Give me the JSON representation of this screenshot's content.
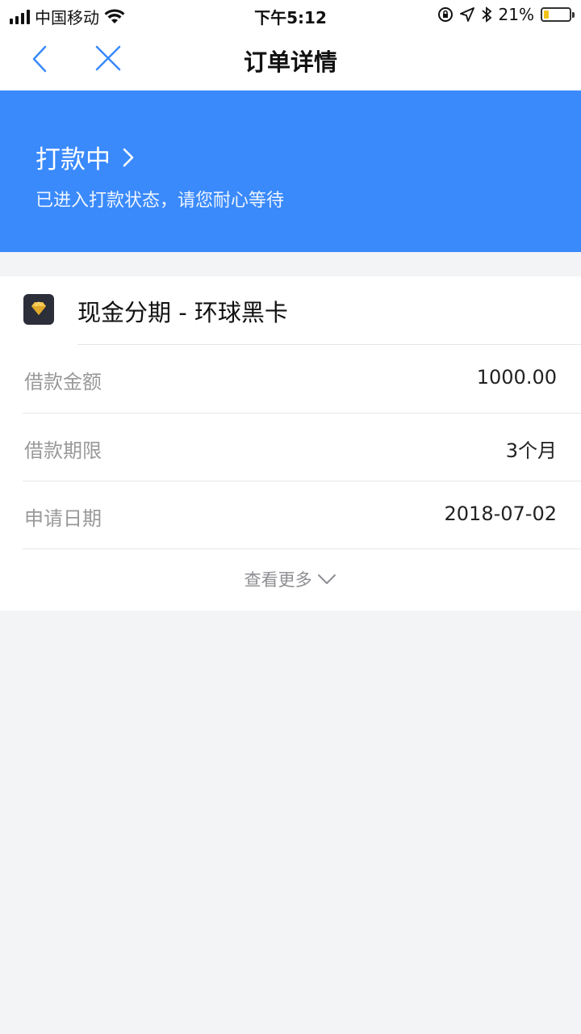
{
  "status_bar": {
    "carrier": "中国移动",
    "time": "下午5:12",
    "battery_percent": "21%",
    "battery_level": 0.21
  },
  "nav": {
    "title": "订单详情"
  },
  "banner": {
    "status": "打款中",
    "message": "已进入打款状态，请您耐心等待",
    "color": "#3a8afc"
  },
  "product": {
    "name": "现金分期 - 环球黑卡",
    "icon": "diamond-icon"
  },
  "details": [
    {
      "label": "借款金额",
      "value": "1000.00"
    },
    {
      "label": "借款期限",
      "value": "3个月"
    },
    {
      "label": "申请日期",
      "value": "2018-07-02"
    }
  ],
  "more": {
    "label": "查看更多"
  }
}
